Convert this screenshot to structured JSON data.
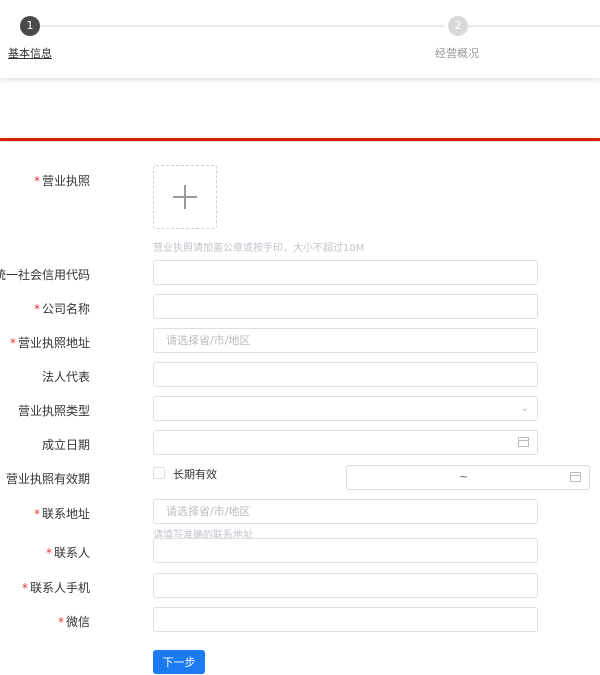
{
  "steps": [
    {
      "number": "1",
      "label": "基本信息",
      "active": true
    },
    {
      "number": "2",
      "label": "经营概况",
      "active": false
    }
  ],
  "form": {
    "license": {
      "label": "营业执照",
      "required": true,
      "hint": "营业执照请加盖公章或按手印，大小不超过10M"
    },
    "credit_code": {
      "label": "统一社会信用代码",
      "required": false
    },
    "company_name": {
      "label": "公司名称",
      "required": true
    },
    "license_address": {
      "label": "营业执照地址",
      "required": true,
      "placeholder": "请选择省/市/地区"
    },
    "legal_rep": {
      "label": "法人代表",
      "required": false
    },
    "license_type": {
      "label": "营业执照类型",
      "required": false
    },
    "found_date": {
      "label": "成立日期",
      "required": false
    },
    "license_validity": {
      "label": "营业执照有效期",
      "required": false,
      "checkbox_label": "长期有效",
      "range_separator": "~"
    },
    "contact_address": {
      "label": "联系地址",
      "required": true,
      "placeholder": "请选择省/市/地区",
      "hint": "请填写准确的联系地址"
    },
    "contact_person": {
      "label": "联系人",
      "required": true
    },
    "contact_phone": {
      "label": "联系人手机",
      "required": true
    },
    "wechat": {
      "label": "微信",
      "required": true
    }
  },
  "required_mark": "*",
  "next_button": "下一步",
  "colors": {
    "primary": "#1a7bf2",
    "required": "#e4393c",
    "divider": "#d81e06"
  }
}
